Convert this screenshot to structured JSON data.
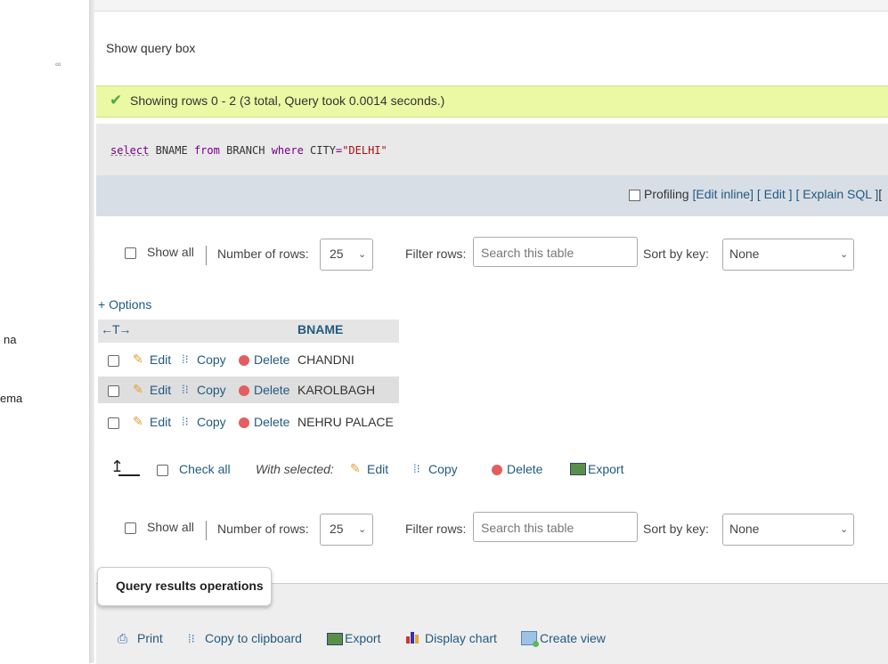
{
  "sidebar": {
    "items": [
      "na",
      "ema"
    ],
    "link_icon": "∞"
  },
  "query_box_link": "Show query box",
  "success": {
    "icon": "check-icon",
    "message": "Showing rows 0 - 2 (3 total, Query took 0.0014 seconds.)",
    "color": "#ebf8a4"
  },
  "sql": {
    "select": "select",
    "col": "BNAME",
    "from": "from",
    "table": "BRANCH",
    "where": "where",
    "field": "CITY",
    "eq": "=",
    "value": "\"DELHI\""
  },
  "profiling": {
    "label": "Profiling",
    "links": [
      "[Edit inline]",
      "[ Edit ]",
      "[ Explain SQL ]",
      "["
    ]
  },
  "nav": {
    "show_all": "Show all",
    "number_of_rows_label": "Number of rows:",
    "rows_value": "25",
    "filter_label": "Filter rows:",
    "filter_placeholder": "Search this table",
    "sort_label": "Sort by key:",
    "sort_value": "None"
  },
  "results": {
    "options_link": "+ Options",
    "arrows": "←T→",
    "column_header": "BNAME",
    "actions": {
      "edit": "Edit",
      "copy": "Copy",
      "delete": "Delete"
    },
    "rows": [
      "CHANDNI",
      "KAROLBAGH",
      "NEHRU PALACE"
    ]
  },
  "bulk": {
    "check_all": "Check all",
    "with_selected": "With selected:",
    "edit": "Edit",
    "copy": "Copy",
    "delete": "Delete",
    "export": "Export"
  },
  "operations": {
    "title": "Query results operations",
    "items": [
      "Print",
      "Copy to clipboard",
      "Export",
      "Display chart",
      "Create view"
    ]
  },
  "colors": {
    "link": "#235a81",
    "profile_bar": "#d7dee6",
    "sql_box": "#e9e9e9"
  }
}
